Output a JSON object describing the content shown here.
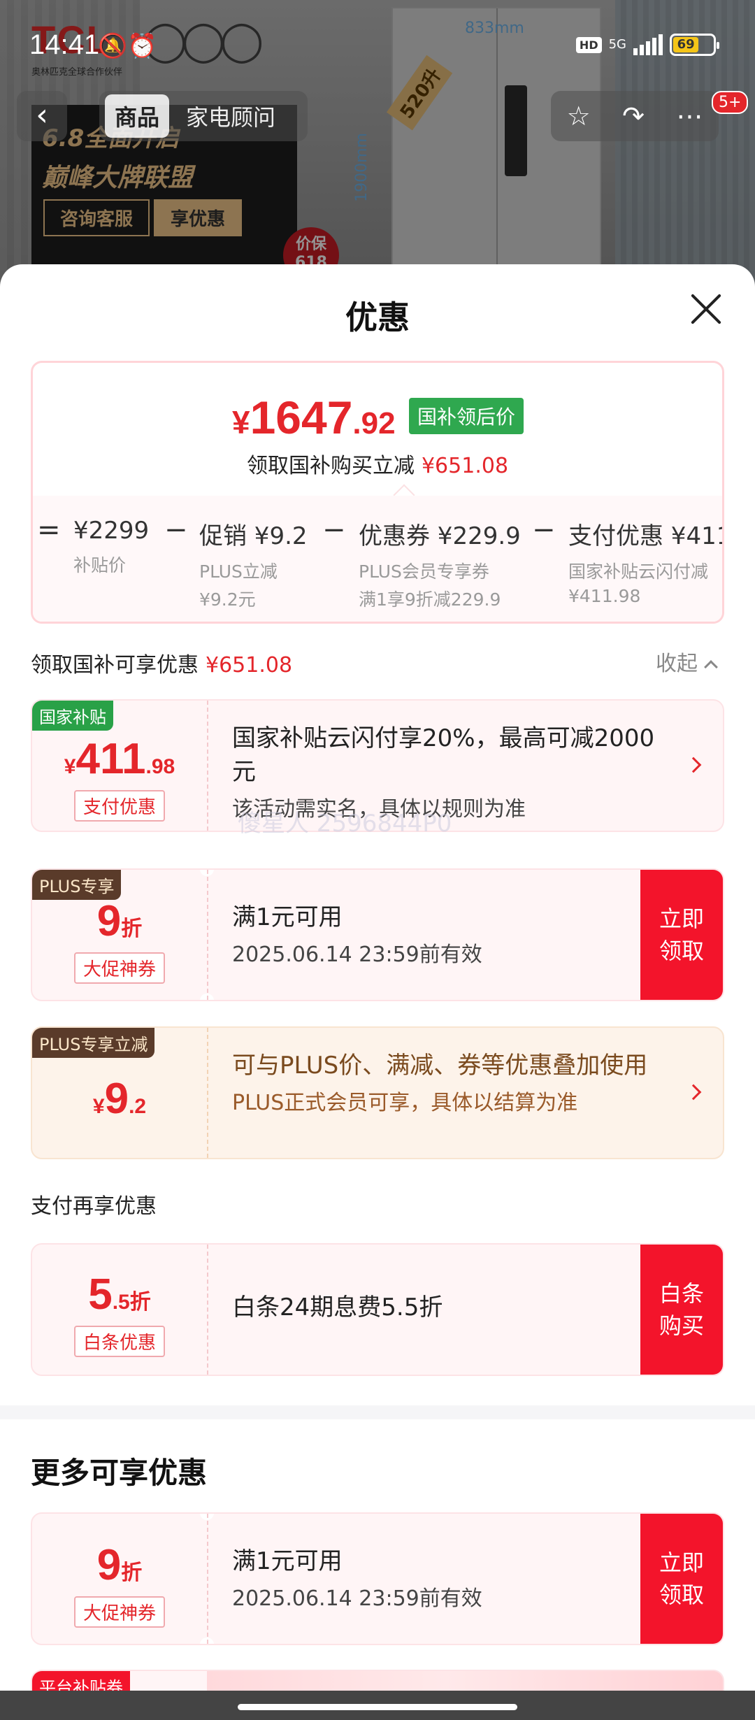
{
  "status_bar": {
    "time": "14:41",
    "hd": "HD",
    "network": "5G",
    "battery": "69"
  },
  "background": {
    "brand_logo": "TCL",
    "brand_sub": "奥林匹克全球合作伙伴",
    "dim_width": "833mm",
    "dim_height": "1900mm",
    "capacity": "520升",
    "promo_line1": "6.8全面开启",
    "promo_line2": "巅峰大牌联盟",
    "promo_btn1": "咨询客服",
    "promo_btn2": "享优惠",
    "badge": "价保618"
  },
  "nav": {
    "tabs": [
      {
        "label": "商品"
      },
      {
        "label": "家电顾问"
      }
    ],
    "cart_count": "5+"
  },
  "sheet": {
    "title": "优惠"
  },
  "summary": {
    "price_symbol": "¥",
    "price_int": "1647",
    "price_dec": ".92",
    "price_tag": "国补领后价",
    "sub_text": "领取国补购买立减",
    "sub_amount": "¥651.08",
    "equals": "=",
    "minus": "−",
    "calc": [
      {
        "main": "¥2299",
        "s1": "补贴价",
        "s2": ""
      },
      {
        "main": "促销 ¥9.2",
        "s1": "PLUS立减",
        "s2": "¥9.2元"
      },
      {
        "main": "优惠券 ¥229.9",
        "s1": "PLUS会员专享券",
        "s2": "满1享9折减229.9"
      },
      {
        "main": "支付优惠 ¥411",
        "s1": "国家补贴云闪付减",
        "s2": "¥411.98"
      }
    ]
  },
  "section1": {
    "label": "领取国补可享优惠",
    "amount": "¥651.08",
    "collapse": "收起"
  },
  "cards": [
    {
      "corner": "国家补贴",
      "big_sym": "¥",
      "big_int": "411",
      "big_dec": ".98",
      "pill": "支付优惠",
      "t1": "国家补贴云闪付享20%，最高可减2000元",
      "t2": "该活动需实名，具体以规则为准"
    },
    {
      "corner": "PLUS专享",
      "big_int": "9",
      "big_unit": "折",
      "pill": "大促神券",
      "t1": "满1元可用",
      "t2": "2025.06.14 23:59前有效",
      "cta": "立即领取"
    },
    {
      "corner": "PLUS专享立减",
      "big_sym": "¥",
      "big_int": "9",
      "big_dec": ".2",
      "t1": "可与PLUS价、满减、券等优惠叠加使用",
      "t2": "PLUS正式会员可享，具体以结算为准"
    }
  ],
  "section2": {
    "label": "支付再享优惠"
  },
  "pay_card": {
    "big_int": "5",
    "big_dec": ".5",
    "big_unit": "折",
    "pill": "白条优惠",
    "t1": "白条24期息费5.5折",
    "cta": "白条购买"
  },
  "watermark": "傻星人 2596844P0",
  "more": {
    "title": "更多可享优惠",
    "card": {
      "big_int": "9",
      "big_unit": "折",
      "pill": "大促神券",
      "t1": "满1元可用",
      "t2": "2025.06.14 23:59前有效",
      "cta": "立即领取"
    },
    "partial_corner": "平台补贴券"
  },
  "colors": {
    "accent": "#e4262b",
    "cta": "#f3142b",
    "green": "#29a147",
    "plus_brown": "#5a3b2a"
  }
}
